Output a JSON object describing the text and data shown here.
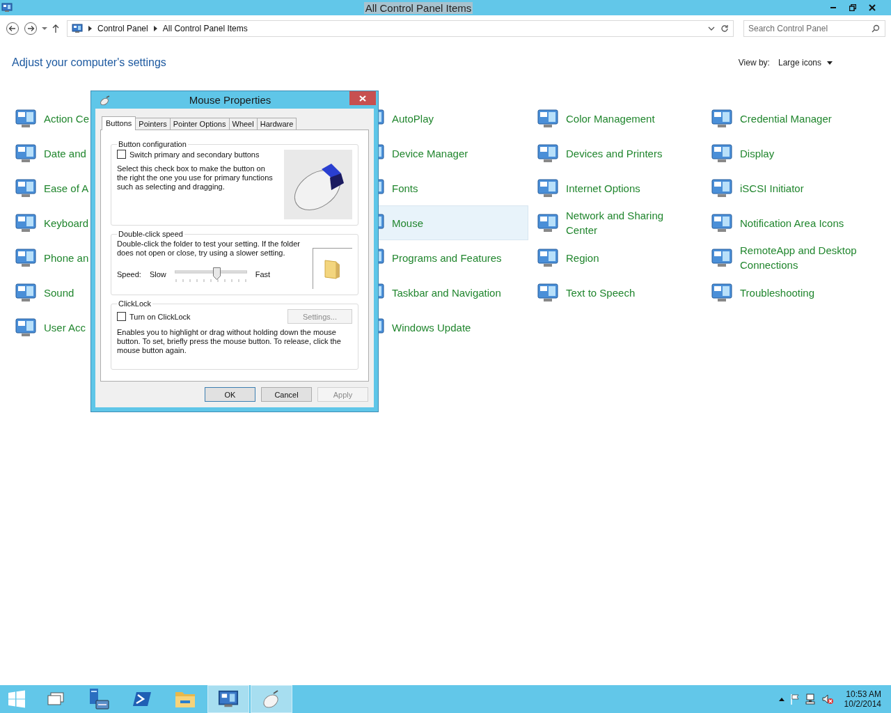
{
  "window": {
    "title": "All Control Panel Items"
  },
  "address_bar": {
    "breadcrumbs": [
      "Control Panel",
      "All Control Panel Items"
    ]
  },
  "search": {
    "placeholder": "Search Control Panel"
  },
  "header": {
    "title": "Adjust your computer's settings",
    "view_by_label": "View by:",
    "view_by_value": "Large icons"
  },
  "columns": [
    {
      "items": [
        {
          "label": "Action Ce",
          "highlighted": false
        },
        {
          "label": "Date and",
          "highlighted": false
        },
        {
          "label": "Ease of A",
          "highlighted": false
        },
        {
          "label": "Keyboard",
          "highlighted": false
        },
        {
          "label": "Phone an",
          "highlighted": false
        },
        {
          "label": "Sound",
          "highlighted": false
        },
        {
          "label": "User Acc",
          "highlighted": false
        }
      ]
    },
    {
      "items": [
        {
          "label": "AutoPlay",
          "highlighted": false
        },
        {
          "label": "Device Manager",
          "highlighted": false
        },
        {
          "label": "Fonts",
          "highlighted": false
        },
        {
          "label": "Mouse",
          "highlighted": true
        },
        {
          "label": "Programs and Features",
          "highlighted": false
        },
        {
          "label": "Taskbar and Navigation",
          "highlighted": false
        },
        {
          "label": "Windows Update",
          "highlighted": false
        }
      ]
    },
    {
      "items": [
        {
          "label": "Color Management",
          "highlighted": false
        },
        {
          "label": "Devices and Printers",
          "highlighted": false
        },
        {
          "label": "Internet Options",
          "highlighted": false
        },
        {
          "label": "Network and Sharing Center",
          "highlighted": false
        },
        {
          "label": "Region",
          "highlighted": false
        },
        {
          "label": "Text to Speech",
          "highlighted": false
        }
      ]
    },
    {
      "items": [
        {
          "label": "Credential Manager",
          "highlighted": false
        },
        {
          "label": "Display",
          "highlighted": false
        },
        {
          "label": "iSCSI Initiator",
          "highlighted": false
        },
        {
          "label": "Notification Area Icons",
          "highlighted": false
        },
        {
          "label": "RemoteApp and Desktop Connections",
          "highlighted": false
        },
        {
          "label": "Troubleshooting",
          "highlighted": false
        }
      ]
    }
  ],
  "dialog": {
    "title": "Mouse Properties",
    "tabs": [
      {
        "label": "Buttons",
        "selected": true
      },
      {
        "label": "Pointers",
        "selected": false
      },
      {
        "label": "Pointer Options",
        "selected": false
      },
      {
        "label": "Wheel",
        "selected": false
      },
      {
        "label": "Hardware",
        "selected": false
      }
    ],
    "button_configuration": {
      "legend": "Button configuration",
      "checkbox": {
        "label": "Switch primary and secondary buttons",
        "checked": false
      },
      "description": "Select this check box to make the button on the right the one you use for primary functions such as selecting and dragging."
    },
    "double_click_speed": {
      "legend": "Double-click speed",
      "description": "Double-click the folder to test your setting. If the folder does not open or close, try using a slower setting.",
      "speed_label": "Speed:",
      "slow_label": "Slow",
      "fast_label": "Fast",
      "level": 0.58
    },
    "clicklock": {
      "legend": "ClickLock",
      "checkbox": {
        "label": "Turn on ClickLock",
        "checked": false
      },
      "settings_button": {
        "label": "Settings...",
        "disabled": true
      },
      "description": "Enables you to highlight or drag without holding down the mouse button. To set, briefly press the mouse button. To release, click the mouse button again."
    },
    "buttons": [
      {
        "label": "OK",
        "disabled": false,
        "default": true
      },
      {
        "label": "Cancel",
        "disabled": false,
        "default": false
      },
      {
        "label": "Apply",
        "disabled": true,
        "default": false
      }
    ]
  },
  "taskbar": {
    "apps": [
      {
        "kind": "start",
        "selected": false
      },
      {
        "kind": "windows",
        "selected": false
      },
      {
        "kind": "server-manager",
        "selected": false
      },
      {
        "kind": "powershell",
        "selected": false
      },
      {
        "kind": "explorer",
        "selected": false
      },
      {
        "kind": "control-panel",
        "selected": true
      },
      {
        "kind": "mouse",
        "selected": true
      }
    ],
    "time": "10:53 AM",
    "date": "10/2/2014"
  }
}
